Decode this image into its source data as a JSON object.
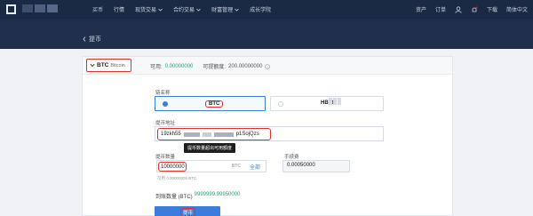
{
  "nav": {
    "left": [
      {
        "label": "买币",
        "dropdown": false
      },
      {
        "label": "行情",
        "dropdown": false
      },
      {
        "label": "现货交易",
        "dropdown": true
      },
      {
        "label": "合约交易",
        "dropdown": true
      },
      {
        "label": "财富管理",
        "dropdown": true
      },
      {
        "label": "成长学院",
        "dropdown": false
      }
    ],
    "right": {
      "assets": "资产",
      "orders": "订单",
      "download": "下载",
      "language": "简体中文"
    }
  },
  "page": {
    "back_icon": "chevron-left-icon",
    "title": "提币"
  },
  "coin": {
    "code": "BTC",
    "name": "Bitcoin",
    "available_label": "可用:",
    "available_value": "0.00000000",
    "limit_label": "可提额度:",
    "limit_value": "200.00000000"
  },
  "chain": {
    "label": "链名称",
    "options": [
      "BTC",
      "HBTC"
    ],
    "selected": "BTC"
  },
  "address": {
    "label": "提币地址",
    "prefix": "19zkh55",
    "suffix": "p1SojQzs",
    "tooltip": "提币数量超出可用额度"
  },
  "amount": {
    "label": "提币数量",
    "value": "10000000",
    "unit": "BTC",
    "all_label": "全部",
    "available_hint": "可用 0.00000000 BTC"
  },
  "fee": {
    "label": "手续费",
    "value": "0.00050000"
  },
  "receive": {
    "label": "到账数量 (BTC)",
    "value": "9999999.99950000"
  },
  "submit": {
    "label": "提币"
  },
  "colors": {
    "nav_bg": "#1b2a44",
    "accent": "#3b7cdd",
    "green": "#1ea672",
    "highlight_red": "#e0322b"
  }
}
